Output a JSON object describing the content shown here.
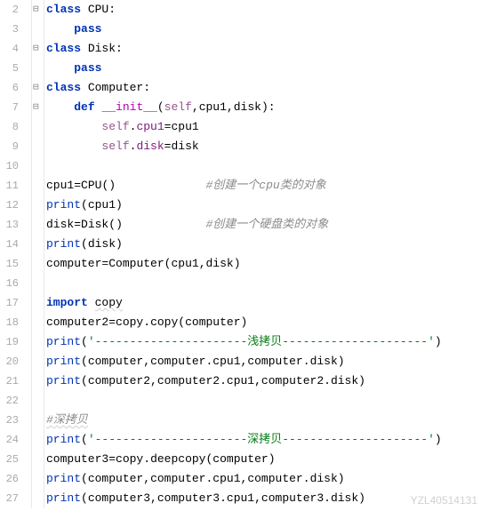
{
  "lines": [
    {
      "num": "2",
      "fold": true
    },
    {
      "num": "3",
      "fold": false
    },
    {
      "num": "4",
      "fold": true
    },
    {
      "num": "5",
      "fold": false
    },
    {
      "num": "6",
      "fold": true
    },
    {
      "num": "7",
      "fold": true
    },
    {
      "num": "8",
      "fold": false
    },
    {
      "num": "9",
      "fold": false
    },
    {
      "num": "10",
      "fold": false
    },
    {
      "num": "11",
      "fold": false
    },
    {
      "num": "12",
      "fold": false
    },
    {
      "num": "13",
      "fold": false
    },
    {
      "num": "14",
      "fold": false
    },
    {
      "num": "15",
      "fold": false
    },
    {
      "num": "16",
      "fold": false
    },
    {
      "num": "17",
      "fold": false
    },
    {
      "num": "18",
      "fold": false
    },
    {
      "num": "19",
      "fold": false
    },
    {
      "num": "20",
      "fold": false
    },
    {
      "num": "21",
      "fold": false
    },
    {
      "num": "22",
      "fold": false
    },
    {
      "num": "23",
      "fold": false
    },
    {
      "num": "24",
      "fold": false
    },
    {
      "num": "25",
      "fold": false
    },
    {
      "num": "26",
      "fold": false
    },
    {
      "num": "27",
      "fold": false
    }
  ],
  "tok": {
    "kw_class": "class",
    "kw_pass": "pass",
    "kw_def": "def",
    "kw_import": "import",
    "cls_cpu": "CPU",
    "cls_disk": "Disk",
    "cls_computer": "Computer",
    "init": "__init__",
    "self": "self",
    "p_cpu1": "cpu1",
    "p_disk": "disk",
    "attr_cpu1": "cpu1",
    "attr_disk": "disk",
    "var_cpu1": "cpu1",
    "var_disk": "disk",
    "var_computer": "computer",
    "var_computer2": "computer2",
    "var_computer3": "computer3",
    "mod_copy": "copy",
    "fn_copy": "copy",
    "fn_deepcopy": "deepcopy",
    "fn_print": "print",
    "c_cpu": "#创建一个cpu类的对象",
    "c_disk": "#创建一个硬盘类的对象",
    "c_deep": "#深拷贝",
    "str_shallow": "'----------------------浅拷贝---------------------'",
    "str_deep": "'----------------------深拷贝---------------------'",
    "colon": ":",
    "dot": ".",
    "eq": "=",
    "lp": "(",
    "rp": ")",
    "comma": ","
  },
  "watermark": "YZL40514131"
}
